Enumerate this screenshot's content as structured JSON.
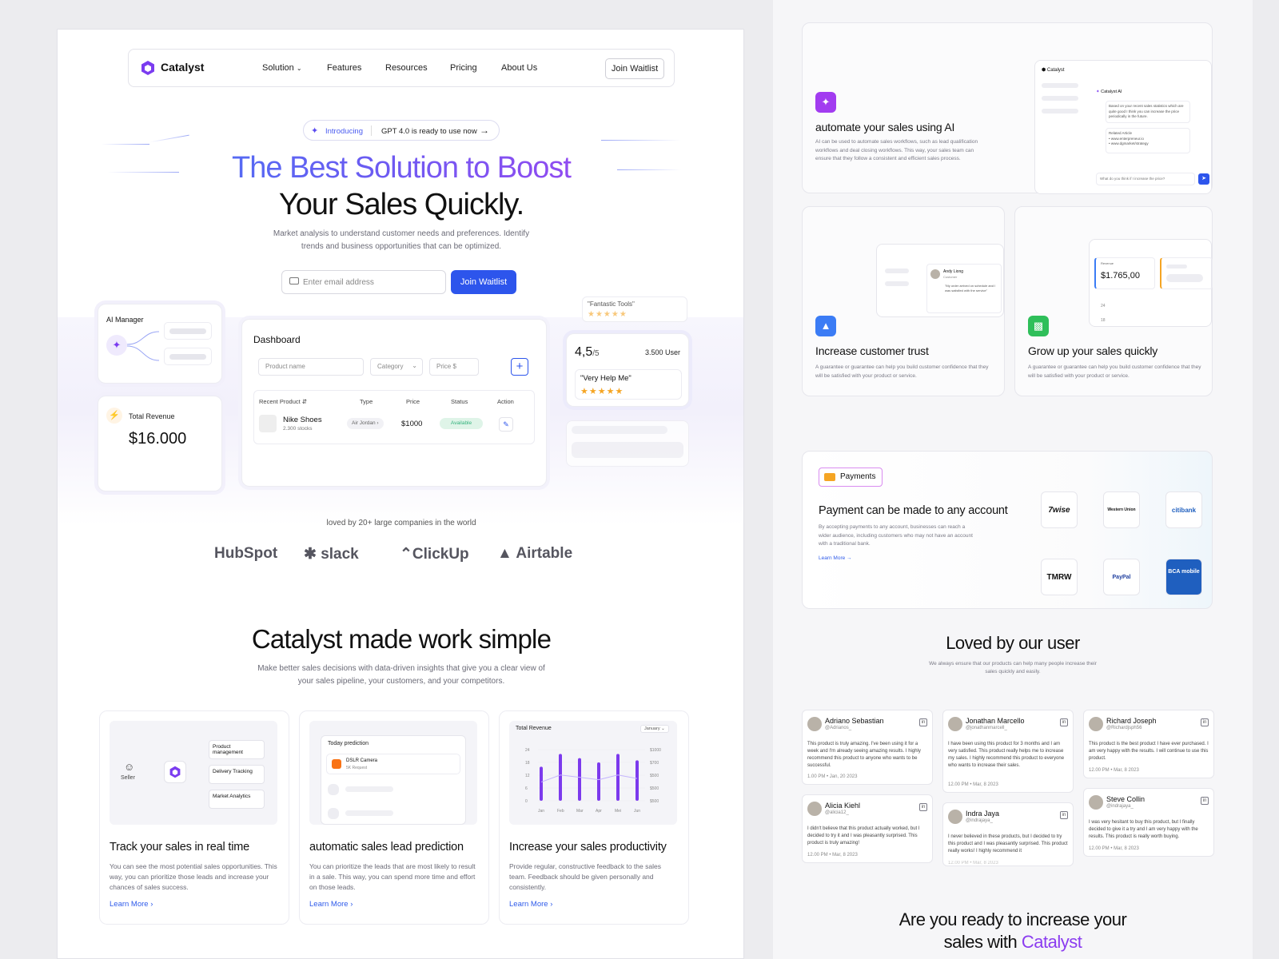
{
  "nav": {
    "brand": "Catalyst",
    "items": [
      "Solution",
      "Features",
      "Resources",
      "Pricing",
      "About Us"
    ],
    "cta": "Join Waitlist"
  },
  "hero": {
    "pill_tag": "Introducing",
    "pill_text": "GPT 4.0 is ready to use now",
    "title_line1": "The Best Solution to Boost",
    "title_line2": "Your Sales Quickly.",
    "subtitle": "Market analysis to understand customer needs and preferences. Identify trends and business opportunities that can be optimized.",
    "email_placeholder": "Enter email address",
    "cta": "Join Waitlist"
  },
  "ai_manager": {
    "label": "AI Manager"
  },
  "revenue": {
    "label": "Total Revenue",
    "value": "$16.000"
  },
  "dashboard": {
    "title": "Dashboard",
    "filters": {
      "product": "Product name",
      "category": "Category",
      "price": "Price $"
    },
    "columns": [
      "Recent Product",
      "Type",
      "Price",
      "Status",
      "Action"
    ],
    "row": {
      "name": "Nike Shoes",
      "stock": "2.300 stocks",
      "type": "Air Jordan",
      "price": "$1000",
      "status": "Available"
    }
  },
  "rating": {
    "fantastic": "\"Fantastic Tools\"",
    "score": "4,5",
    "out_of": "/5",
    "users": "3.500 User",
    "quote": "\"Very Help Me\""
  },
  "companies": {
    "text": "loved by 20+ large companies in the world",
    "logos": [
      "HubSpot",
      "slack",
      "ClickUp",
      "Airtable"
    ]
  },
  "features": {
    "title": "Catalyst made work simple",
    "subtitle": "Make better sales decisions with data-driven insights that give you a clear view of your sales pipeline, your customers, and your competitors.",
    "cards": [
      {
        "title": "Track your sales in real time",
        "desc": "You can see the most potential sales opportunities. This way, you can prioritize those leads and increase your chances of sales success.",
        "link": "Learn More"
      },
      {
        "title": "automatic sales lead prediction",
        "desc": "You can prioritize the leads that are most likely to result in a sale. This way, you can spend more time and effort on those leads.",
        "link": "Learn More"
      },
      {
        "title": "Increase your sales productivity",
        "desc": "Provide regular, constructive feedback to the sales team. Feedback should be given personally and consistently.",
        "link": "Learn More"
      }
    ],
    "card1_img": {
      "seller": "Seller",
      "nodes": [
        "Product management",
        "Delivery Tracking",
        "Market Analytics"
      ]
    },
    "card2_img": {
      "title": "Today prediction",
      "item": "DSLR Camera",
      "item_sub": "5K Request"
    },
    "card3_img": {
      "title": "Total Revenue",
      "month": "January",
      "y_left": [
        "24",
        "18",
        "12",
        "6",
        "0"
      ],
      "y_right": [
        "$1000",
        "$700",
        "$500",
        "$500",
        "$500"
      ],
      "months": [
        "Jan",
        "Feb",
        "Mar",
        "Apr",
        "Mei",
        "Jun"
      ]
    }
  },
  "chart_data": {
    "type": "bar",
    "title": "Total Revenue",
    "categories": [
      "Jan",
      "Feb",
      "Mar",
      "Apr",
      "Mei",
      "Jun"
    ],
    "series": [
      {
        "name": "",
        "values": [
          16,
          22,
          20,
          18,
          22,
          19
        ]
      }
    ],
    "ylim": [
      0,
      24
    ]
  },
  "right": {
    "ai": {
      "title": "automate your sales using AI",
      "desc": "AI can be used to automate sales workflows, such as lead qualification workflows and deal closing workflows. This way, your sales team can ensure that they follow a consistent and efficient sales process.",
      "brand": "Catalyst",
      "bot": "Catalyst AI",
      "bot_msg": "Based on your recent sales statistics which are quite good I think you can increase the price periodically in the future.",
      "related": "Related Article",
      "links": [
        "www.enterpreneur.io",
        "www.dgmarket/strategy"
      ],
      "input": "What do you think if I increase the price?"
    },
    "trust": {
      "title": "Increase customer trust",
      "desc": "A guarantee or guarantee can help you build customer confidence that they will be satisfied with your product or service.",
      "name": "Andy Liong",
      "role": "Customer",
      "msg": "\"My order arrived on schedule and I was satisfied with the service\""
    },
    "grow": {
      "title": "Grow up your sales quickly",
      "desc": "A guarantee or guarantee can help you build customer confidence that they will be satisfied with your product or service.",
      "label": "Revenue",
      "value": "$1.765,00",
      "ticks": [
        "24",
        "18"
      ]
    },
    "payments": {
      "tag": "Payments",
      "title": "Payment can be made to any account",
      "desc": "By accepting payments to any account, businesses can reach a wider audience, including customers who may not have an account with a traditional bank.",
      "link": "Learn More",
      "banks": [
        "7wise",
        "Western Union",
        "citibank",
        "TMRW",
        "PayPal",
        "BCA mobile"
      ]
    },
    "loved": {
      "title": "Loved by our user",
      "subtitle": "We always ensure that our products can help many people increase their sales quickly and easily."
    },
    "testimonials": [
      {
        "name": "Adriano Sebastian",
        "handle": "@Adrianos_",
        "body": "This product is truly amazing. I've been using it for a week and I'm already seeing amazing results. I highly recommend this product to anyone who wants to be successful.",
        "date": "1.00 PM  •  Jan, 20 2023"
      },
      {
        "name": "Jonathan Marcello",
        "handle": "@jonathanmarcell_",
        "body": "I have been using this product for 3 months and I am very satisfied. This product really helps me to increase my sales. I highly recommend this product to everyone who wants to increase their sales.",
        "date": "12.00 PM  •  Mar, 8 2023"
      },
      {
        "name": "Richard Joseph",
        "handle": "@Richardjsph56",
        "body": "This product is the best product I have ever purchased. I am very happy with the results. I will continue to use this product.",
        "date": "12.00 PM  •  Mar, 8 2023"
      },
      {
        "name": "Alicia Kiehl",
        "handle": "@alicia12_",
        "body": "I didn't believe that this product actually worked, but I decided to try it and I was pleasantly surprised. This product is truly amazing!",
        "date": "12.00 PM  •  Mar, 8 2023"
      },
      {
        "name": "Indra Jaya",
        "handle": "@indrajaya_",
        "body": "I never believed in these products, but I decided to try this product and I was pleasantly surprised. This product really works! I highly recommend it",
        "date": "12.00 PM  •  Mar, 8 2023"
      },
      {
        "name": "Steve Collin",
        "handle": "@indrajaya_",
        "body": "I was very hesitant to buy this product, but I finally decided to give it a try and I am very happy with the results. This product is really worth buying.",
        "date": "12.00 PM  •  Mar, 8 2023"
      }
    ],
    "cta_line1": "Are you ready to increase your",
    "cta_line2_a": "sales with ",
    "cta_line2_b": "Catalyst"
  },
  "colors": {
    "accent": "#2d55ec",
    "purple": "#8b3cf0",
    "star": "#f5a524",
    "green": "#36b37e"
  }
}
